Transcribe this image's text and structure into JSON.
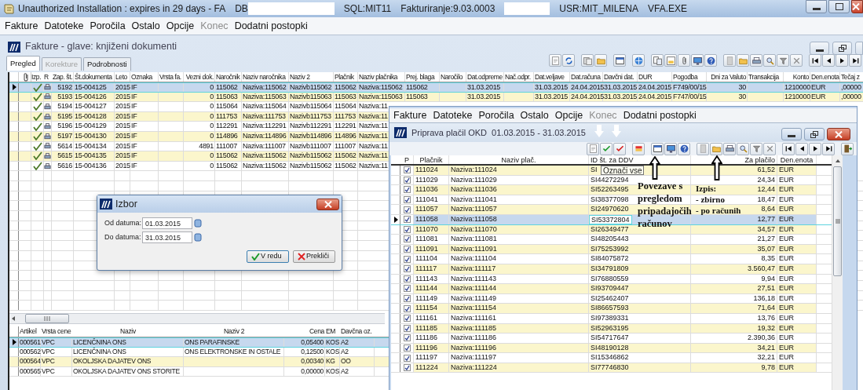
{
  "app_window": {
    "title_segments": [
      {
        "kind": "text",
        "text": "Unauthorized Installation : expires in 29 days - FA"
      },
      {
        "kind": "text",
        "text": "DB"
      },
      {
        "kind": "redacted"
      },
      {
        "kind": "text",
        "text": "SQL:MIT11"
      },
      {
        "kind": "text",
        "text": "Fakturiranje:9.03.0003"
      },
      {
        "kind": "redacted"
      },
      {
        "kind": "text",
        "text": "USR:MIT_MILENA"
      },
      {
        "kind": "text",
        "text": "VFA.EXE"
      }
    ],
    "menu": [
      {
        "label": "Fakture",
        "disabled": false
      },
      {
        "label": "Datoteke",
        "disabled": false
      },
      {
        "label": "Poročila",
        "disabled": false
      },
      {
        "label": "Ostalo",
        "disabled": false
      },
      {
        "label": "Opcije",
        "disabled": false
      },
      {
        "label": "Konec",
        "disabled": true
      },
      {
        "label": "Dodatni postopki",
        "disabled": false
      }
    ]
  },
  "documents_window": {
    "title": "Fakture - glave: knjiženi dokumenti",
    "tabs": [
      {
        "label": "Pregled",
        "selected": true,
        "disabled": false
      },
      {
        "label": "Korekture",
        "selected": false,
        "disabled": true
      },
      {
        "label": "Podrobnosti",
        "selected": false,
        "disabled": false
      }
    ],
    "table": {
      "icon_columns": [
        "Izp.",
        "R"
      ],
      "columns": [
        "Zap. št.",
        "Št.dokumenta",
        "Leto",
        "Oznaka",
        "Vrsta fa.",
        "Vezni dok.",
        "Naročnik",
        "Naziv naročnika",
        "Naziv 2",
        "Plačnik",
        "Naziv plačnika",
        "Prej. blaga",
        "Naročilo",
        "Dat.odpreme",
        "Nač.odpr.",
        "Dat.veljave",
        "Dat.računa",
        "Davčni dat.",
        "DUR",
        "Pogodba",
        "Dni za Valuto",
        "Transakcija",
        "Konto",
        "Den.enota",
        "Tečaj z"
      ],
      "rows": [
        {
          "selected": true,
          "cells": [
            "5192",
            "15-004125",
            "2015",
            "IF",
            null,
            "0",
            "115062",
            "Naziva:115062",
            "Nazivb115062",
            "115062",
            "Naziva:115062",
            "115062",
            null,
            "31.03.2015",
            null,
            "31.03.2015",
            "24.04.2015",
            "31.03.2015",
            "24.04.2015",
            "F749/00/15",
            "30",
            null,
            "1210000",
            "EUR",
            ",00000"
          ]
        },
        {
          "selected": false,
          "cells": [
            "5193",
            "15-004126",
            "2015",
            "IF",
            null,
            "0",
            "115063",
            "Naziva:115063",
            "Nazivb115063",
            "115063",
            "Naziva:115063",
            "115063",
            null,
            "31.03.2015",
            null,
            "31.03.2015",
            "24.04.2015",
            "31.03.2015",
            "24.04.2015",
            "F747/00/15",
            "30",
            null,
            "1210000",
            "EUR",
            ",00000"
          ]
        },
        {
          "selected": false,
          "cells": [
            "5194",
            "15-004127",
            "2015",
            "IF",
            null,
            "0",
            "115064",
            "Naziva:115064",
            "Nazivb115064",
            "115064",
            "Naziva:11"
          ]
        },
        {
          "selected": false,
          "cells": [
            "5195",
            "15-004128",
            "2015",
            "IF",
            null,
            "0",
            "111753",
            "Naziva:111753",
            "Nazivb111753",
            "111753",
            "Naziva:11"
          ]
        },
        {
          "selected": false,
          "cells": [
            "5196",
            "15-004129",
            "2015",
            "IF",
            null,
            "0",
            "112291",
            "Naziva:112291",
            "Nazivb112291",
            "112291",
            "Naziva:11"
          ]
        },
        {
          "selected": false,
          "cells": [
            "5197",
            "15-004130",
            "2015",
            "IF",
            null,
            "0",
            "114896",
            "Naziva:114896",
            "Nazivb114896",
            "114896",
            "Naziva:11"
          ]
        },
        {
          "selected": false,
          "cells": [
            "5614",
            "15-004134",
            "2015",
            "IF",
            null,
            "4891",
            "111007",
            "Naziva:111007",
            "Nazivb111007",
            "111007",
            "Naziva:11"
          ]
        },
        {
          "selected": false,
          "cells": [
            "5615",
            "15-004135",
            "2015",
            "IF",
            null,
            "0",
            "115062",
            "Naziva:115062",
            "Nazivb115062",
            "115062",
            "Naziva:11"
          ]
        },
        {
          "selected": false,
          "cells": [
            "5616",
            "15-004136",
            "2015",
            "IF",
            null,
            "0",
            "115062",
            "Naziva:115062",
            "Nazivb115062",
            "115062",
            "Naziva:11"
          ]
        }
      ]
    },
    "items_table": {
      "columns": [
        "Artikel",
        "Vrsta cene",
        "Naziv",
        "Naziv 2",
        "Cena",
        "EM",
        "Davčna oz."
      ],
      "rows": [
        {
          "selected": true,
          "cells": [
            "000561",
            "VPC",
            "LICENČNINA ONS",
            "ONS PARAFINSKE",
            "0,05400",
            "KOS",
            "A2"
          ]
        },
        {
          "selected": false,
          "cells": [
            "000562",
            "VPC",
            "LICENČNINA ONS",
            "ONS ELEKTRONSKE IN OSTALE",
            "0,12500",
            "KOS",
            "A2"
          ]
        },
        {
          "selected": false,
          "cells": [
            "000564",
            "VPC",
            "OKOLJSKA DAJATEV ONS",
            null,
            "0,00340",
            "KG",
            "OO"
          ]
        },
        {
          "selected": false,
          "cells": [
            "000565",
            "VPC",
            "OKOLJSKA DAJATEV ONS STORITE",
            null,
            "0,00000",
            "KOS",
            "A2"
          ]
        }
      ]
    }
  },
  "dialog": {
    "title": "Izbor",
    "fields": [
      {
        "label": "Od datuma:",
        "value": "01.03.2015"
      },
      {
        "label": "Do datuma:",
        "value": "31.03.2015"
      }
    ],
    "buttons": [
      {
        "kind": "ok",
        "label": "V redu"
      },
      {
        "kind": "cancel",
        "label": "Prekliči"
      }
    ]
  },
  "payments_window": {
    "menu": [
      {
        "label": "Fakture",
        "disabled": false
      },
      {
        "label": "Datoteke",
        "disabled": false
      },
      {
        "label": "Poročila",
        "disabled": false
      },
      {
        "label": "Ostalo",
        "disabled": false
      },
      {
        "label": "Opcije",
        "disabled": false
      },
      {
        "label": "Konec",
        "disabled": true
      },
      {
        "label": "Dodatni postopki",
        "disabled": false
      }
    ],
    "title": "Priprava plačil OKD  01.03.2015 - 31.03.2015",
    "tooltip": "Označi vse",
    "checkbox_column": "P",
    "columns": [
      "Plačnik",
      "Naziv plač.",
      "ID št. za DDV",
      "Za plačilo",
      "Den.enota"
    ],
    "rows": [
      {
        "checked": true,
        "selected": false,
        "cells": [
          "111024",
          "Naziva:111024",
          "SI",
          "61,52",
          "EUR"
        ]
      },
      {
        "checked": true,
        "selected": false,
        "cells": [
          "111029",
          "Naziva:111029",
          "SI44272294",
          "24,34",
          "EUR"
        ]
      },
      {
        "checked": true,
        "selected": false,
        "cells": [
          "111036",
          "Naziva:111036",
          "SI52263495",
          "12,44",
          "EUR"
        ]
      },
      {
        "checked": true,
        "selected": false,
        "cells": [
          "111041",
          "Naziva:111041",
          "SI38377098",
          "18,47",
          "EUR"
        ]
      },
      {
        "checked": true,
        "selected": false,
        "cells": [
          "111057",
          "Naziva:111057",
          "SI24970620",
          "8,64",
          "EUR"
        ]
      },
      {
        "checked": true,
        "selected": true,
        "cells": [
          "111058",
          "Naziva:111058",
          "SI53372804",
          "12,77",
          "EUR"
        ]
      },
      {
        "checked": true,
        "selected": false,
        "cells": [
          "111070",
          "Naziva:111070",
          "SI26349477",
          "34,57",
          "EUR"
        ]
      },
      {
        "checked": true,
        "selected": false,
        "cells": [
          "111081",
          "Naziva:111081",
          "SI48205443",
          "21,27",
          "EUR"
        ]
      },
      {
        "checked": true,
        "selected": false,
        "cells": [
          "111091",
          "Naziva:111091",
          "SI75253992",
          "35,07",
          "EUR"
        ]
      },
      {
        "checked": true,
        "selected": false,
        "cells": [
          "111104",
          "Naziva:111104",
          "SI84075872",
          "8,35",
          "EUR"
        ]
      },
      {
        "checked": true,
        "selected": false,
        "cells": [
          "111117",
          "Naziva:111117",
          "SI34791809",
          "3.560,47",
          "EUR"
        ]
      },
      {
        "checked": true,
        "selected": false,
        "cells": [
          "111143",
          "Naziva:111143",
          "SI76880559",
          "9,94",
          "EUR"
        ]
      },
      {
        "checked": true,
        "selected": false,
        "cells": [
          "111144",
          "Naziva:111144",
          "SI93709447",
          "27,51",
          "EUR"
        ]
      },
      {
        "checked": true,
        "selected": false,
        "cells": [
          "111149",
          "Naziva:111149",
          "SI25462407",
          "136,18",
          "EUR"
        ]
      },
      {
        "checked": true,
        "selected": false,
        "cells": [
          "111154",
          "Naziva:111154",
          "SI86657593",
          "71,64",
          "EUR"
        ]
      },
      {
        "checked": true,
        "selected": false,
        "cells": [
          "111161",
          "Naziva:111161",
          "SI97389331",
          "13,76",
          "EUR"
        ]
      },
      {
        "checked": true,
        "selected": false,
        "cells": [
          "111185",
          "Naziva:111185",
          "SI52963195",
          "19,32",
          "EUR"
        ]
      },
      {
        "checked": true,
        "selected": false,
        "cells": [
          "111186",
          "Naziva:111186",
          "SI54717647",
          "2.390,36",
          "EUR"
        ]
      },
      {
        "checked": true,
        "selected": false,
        "cells": [
          "111196",
          "Naziva:111196",
          "SI48190128",
          "34,21",
          "EUR"
        ]
      },
      {
        "checked": true,
        "selected": false,
        "cells": [
          "111197",
          "Naziva:111197",
          "SI15346862",
          "32,21",
          "EUR"
        ]
      },
      {
        "checked": true,
        "selected": false,
        "cells": [
          "111224",
          "Naziva:111224",
          "SI77746830",
          "9,78",
          "EUR"
        ]
      }
    ],
    "annotations": [
      {
        "kind": "links",
        "lines": [
          "Povezave s",
          "pregledom",
          "pripadajočih",
          "računov"
        ]
      },
      {
        "kind": "print",
        "lines": [
          "Izpis:",
          "- zbirno",
          "- po računih"
        ]
      }
    ]
  }
}
